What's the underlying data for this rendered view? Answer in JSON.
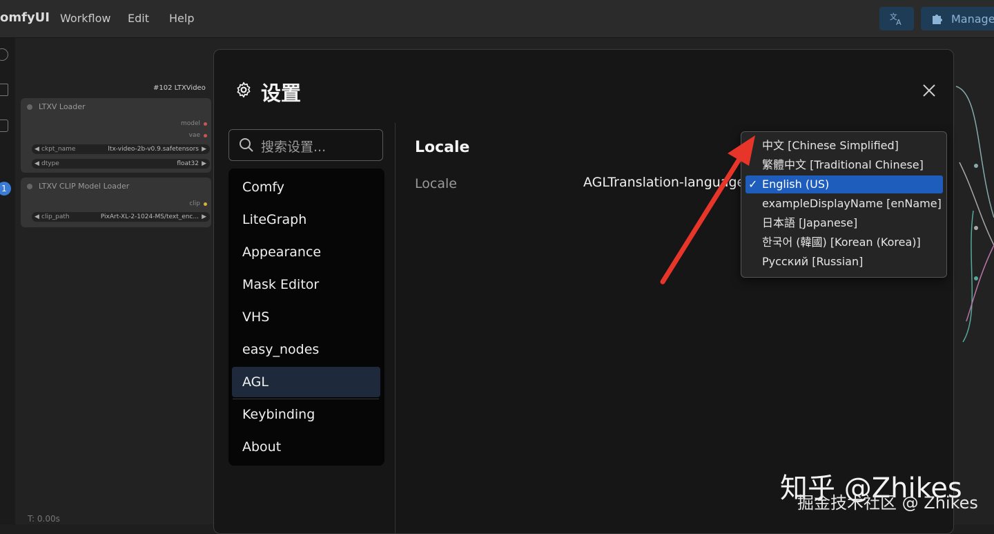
{
  "menubar": {
    "brand": "omfyUI",
    "items": [
      "Workflow",
      "Edit",
      "Help"
    ],
    "manage_label": "Manage"
  },
  "canvas": {
    "node_title_badge": "#102 LTXVideo",
    "badge_count": "1",
    "nodes": [
      {
        "title": "LTXV Loader",
        "outputs": [
          "model",
          "vae"
        ],
        "widgets": [
          {
            "name": "ckpt_name",
            "value": "ltx-video-2b-v0.9.safetensors"
          },
          {
            "name": "dtype",
            "value": "float32"
          }
        ]
      },
      {
        "title": "LTXV CLIP Model Loader",
        "outputs": [
          "clip"
        ],
        "widgets": [
          {
            "name": "clip_path",
            "value": "PixArt-XL-2-1024-MS/text_enc..."
          }
        ]
      }
    ],
    "status": "T: 0.00s"
  },
  "dialog": {
    "title": "设置",
    "search_placeholder": "搜索设置...",
    "categories": [
      "Comfy",
      "LiteGraph",
      "Appearance",
      "Mask Editor",
      "VHS",
      "easy_nodes",
      "AGL",
      "Keybinding",
      "About"
    ],
    "selected_category": "AGL",
    "section_header": "Locale",
    "setting_label": "Locale",
    "setting_value": "AGLTranslation-language"
  },
  "dropdown": {
    "options": [
      "中文 [Chinese Simplified]",
      "繁體中文 [Traditional Chinese]",
      "English (US)",
      "exampleDisplayName [enName]",
      "日本語 [Japanese]",
      "한국어 (韓國) [Korean (Korea)]",
      "Русский [Russian]"
    ],
    "selected_index": 2,
    "check_mark": "✓"
  },
  "watermark": {
    "line1": "知乎 @Zhikes",
    "line2": "掘金技术社区 @ Zhikes"
  },
  "colors": {
    "accent_selected": "#1f5dbd",
    "category_selected_bg": "#1e2a3b",
    "annotation_arrow": "#e8352a"
  }
}
